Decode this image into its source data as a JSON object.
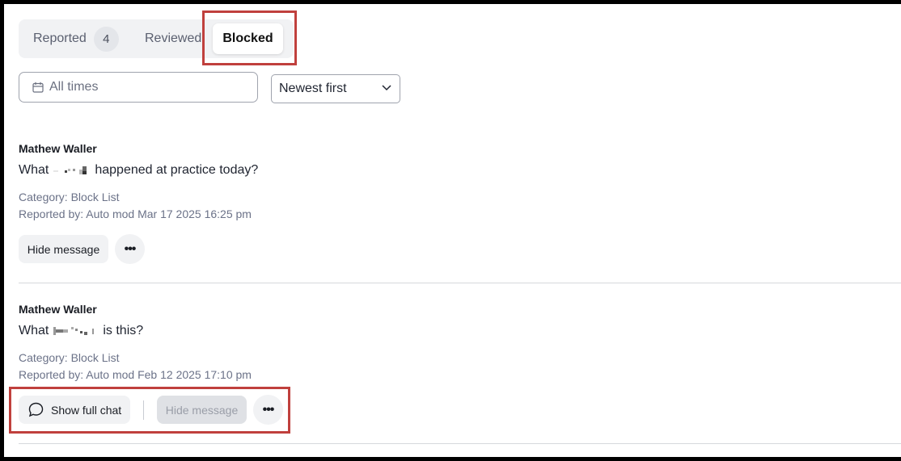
{
  "tabs": {
    "reported_label": "Reported",
    "reported_count": "4",
    "reviewed_label": "Reviewed",
    "blocked_label": "Blocked"
  },
  "filters": {
    "date_value": "All times",
    "sort_value": "Newest first"
  },
  "messages": [
    {
      "author": "Mathew Waller",
      "text_before": "What",
      "text_after": "happened at practice today?",
      "category": "Category: Block List",
      "reported_by": "Reported by: Auto mod Mar 17 2025 16:25 pm",
      "hide_label": "Hide message"
    },
    {
      "author": "Mathew Waller",
      "text_before": "What",
      "text_after": "is this?",
      "category": "Category: Block List",
      "reported_by": "Reported by: Auto mod Feb 12 2025 17:10 pm",
      "show_chat_label": "Show full chat",
      "hide_label": "Hide message"
    }
  ],
  "colors": {
    "highlight": "#c0403d",
    "pill_bg": "#f1f2f4",
    "disabled_bg": "#dfe1e5"
  }
}
